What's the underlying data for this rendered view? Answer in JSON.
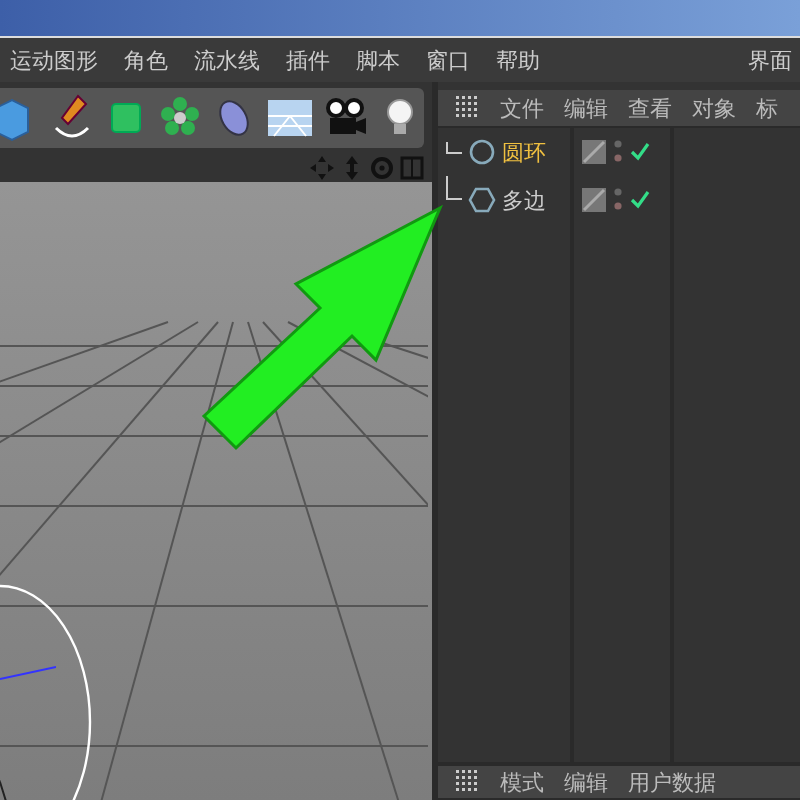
{
  "main_menu": [
    {
      "label": "运动图形"
    },
    {
      "label": "角色"
    },
    {
      "label": "流水线"
    },
    {
      "label": "插件"
    },
    {
      "label": "脚本"
    },
    {
      "label": "窗口"
    },
    {
      "label": "帮助"
    }
  ],
  "layout_label": "界面",
  "object_manager": {
    "menu": [
      "文件",
      "编辑",
      "查看",
      "对象",
      "标"
    ],
    "objects": [
      {
        "name": "圆环",
        "kind": "circle",
        "selected": true,
        "checked": true
      },
      {
        "name": "多边",
        "kind": "polygon",
        "selected": false,
        "checked": true
      }
    ]
  },
  "attributes": {
    "menu": [
      "模式",
      "编辑",
      "用户数据"
    ]
  }
}
